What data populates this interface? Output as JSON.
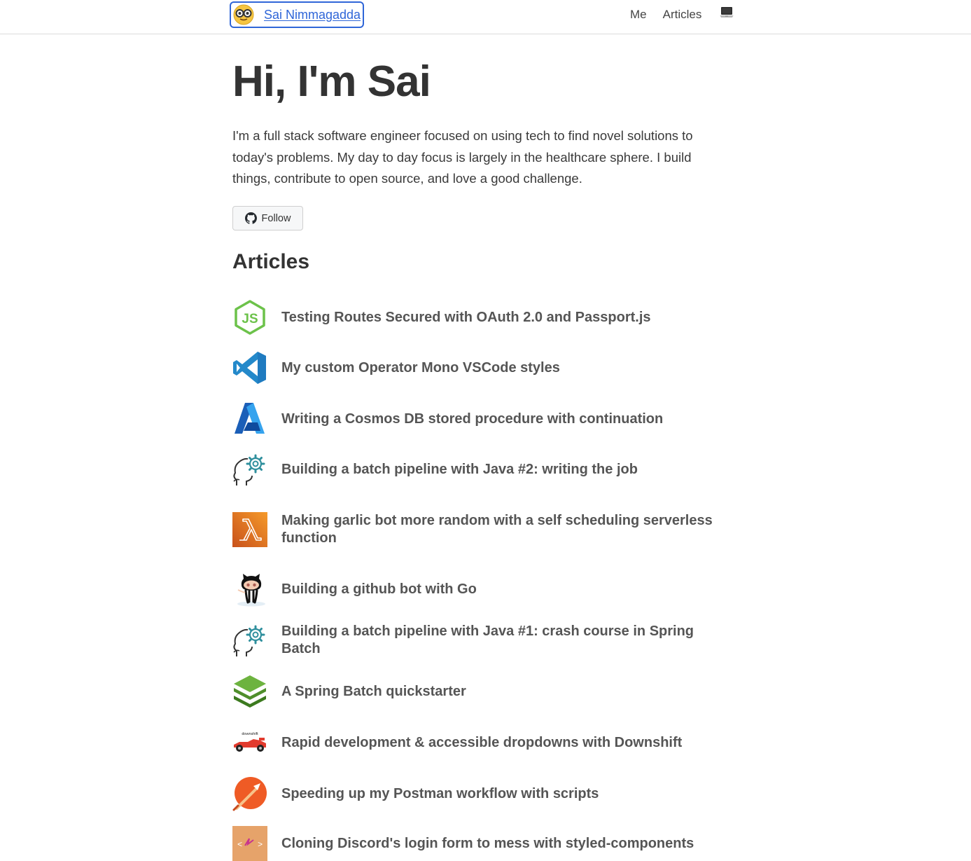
{
  "nav": {
    "brand_name": "Sai Nimmagadda",
    "links": [
      "Me",
      "Articles"
    ],
    "avatar_icon": "glasses-emoji-avatar",
    "theme_icon": "laptop-icon"
  },
  "hero": {
    "title": "Hi, I'm Sai",
    "intro": "I'm a full stack software engineer focused on using tech to find novel solutions to today's problems. My day to day focus is largely in the healthcare sphere. I build things, contribute to open source, and love a good challenge.",
    "follow_label": "Follow"
  },
  "articles": {
    "heading": "Articles",
    "items": [
      {
        "title": "Testing Routes Secured with OAuth 2.0 and Passport.js",
        "icon": "nodejs-icon"
      },
      {
        "title": "My custom Operator Mono VSCode styles",
        "icon": "vscode-icon"
      },
      {
        "title": "Writing a Cosmos DB stored procedure with continuation",
        "icon": "azure-icon"
      },
      {
        "title": "Building a batch pipeline with Java #2: writing the job",
        "icon": "head-gear-icon"
      },
      {
        "title": "Making garlic bot more random with a self scheduling serverless function",
        "icon": "aws-lambda-icon"
      },
      {
        "title": "Building a github bot with Go",
        "icon": "octocat-icon"
      },
      {
        "title": "Building a batch pipeline with Java #1: crash course in Spring Batch",
        "icon": "head-gear-icon"
      },
      {
        "title": "A Spring Batch quickstarter",
        "icon": "spring-batch-icon"
      },
      {
        "title": "Rapid development & accessible dropdowns with Downshift",
        "icon": "downshift-icon",
        "icon_text": "downshift"
      },
      {
        "title": "Speeding up my Postman workflow with scripts",
        "icon": "postman-icon"
      },
      {
        "title": "Cloning Discord's login form to mess with styled-components",
        "icon": "styled-components-icon"
      }
    ]
  },
  "colors": {
    "link": "#2f66d8",
    "text": "#333333",
    "article_title": "#555555",
    "nodejs": "#6cc24a",
    "vscode": "#2489ca",
    "aws_lambda": "#e8741f",
    "postman": "#ef5b25",
    "spring": "#6db33f"
  }
}
